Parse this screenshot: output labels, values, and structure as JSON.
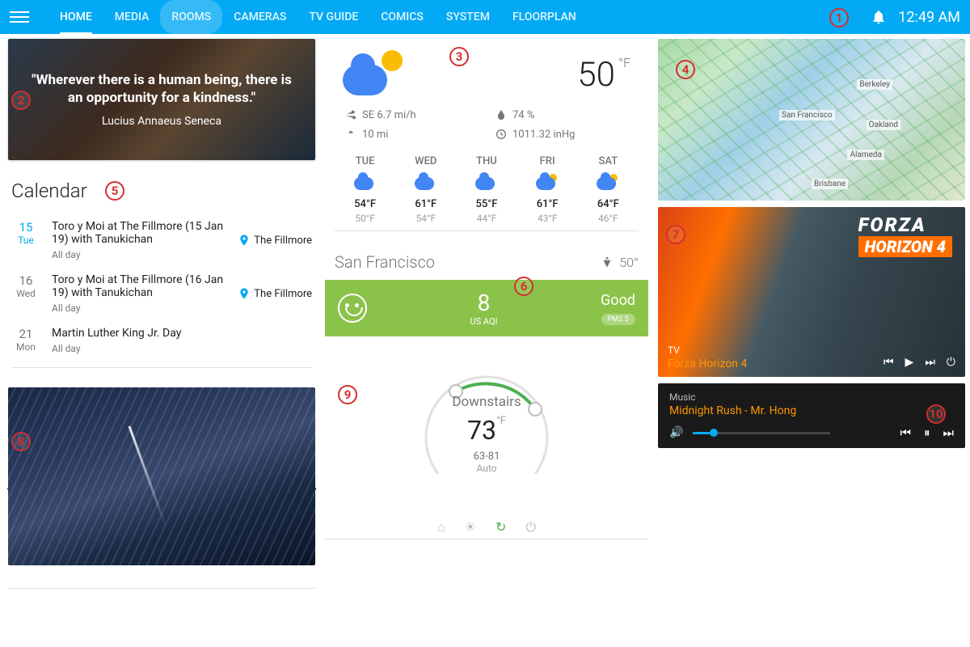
{
  "topbar": {
    "tabs": [
      "HOME",
      "MEDIA",
      "ROOMS",
      "CAMERAS",
      "TV GUIDE",
      "COMICS",
      "SYSTEM",
      "FLOORPLAN"
    ],
    "active_tab": "HOME",
    "highlight_tab": "ROOMS",
    "time": "12:49 AM"
  },
  "quote": {
    "text": "\"Wherever there is a human being, there is an opportunity for a kindness.\"",
    "author": "Lucius Annaeus Seneca"
  },
  "calendar": {
    "title": "Calendar",
    "events": [
      {
        "day": "15",
        "dow": "Tue",
        "highlight": true,
        "title": "Toro y Moi at The Fillmore (15 Jan 19) with Tanukichan",
        "time": "All day",
        "location": "The Fillmore"
      },
      {
        "day": "16",
        "dow": "Wed",
        "highlight": false,
        "title": "Toro y Moi at The Fillmore (16 Jan 19) with Tanukichan",
        "time": "All day",
        "location": "The Fillmore"
      },
      {
        "day": "21",
        "dow": "Mon",
        "highlight": false,
        "title": "Martin Luther King Jr. Day",
        "time": "All day",
        "location": ""
      }
    ]
  },
  "weather": {
    "temp": "50",
    "temp_unit": "°F",
    "wind": "SE 6.7 mi/h",
    "visibility": "10 mi",
    "humidity": "74 %",
    "pressure": "1011.32 inHg",
    "forecast": [
      {
        "day": "TUE",
        "hi": "54°F",
        "lo": "50°F",
        "sun": false
      },
      {
        "day": "WED",
        "hi": "61°F",
        "lo": "54°F",
        "sun": false
      },
      {
        "day": "THU",
        "hi": "55°F",
        "lo": "44°F",
        "sun": false
      },
      {
        "day": "FRI",
        "hi": "61°F",
        "lo": "43°F",
        "sun": true
      },
      {
        "day": "SAT",
        "hi": "64°F",
        "lo": "46°F",
        "sun": true
      }
    ]
  },
  "aqi": {
    "city": "San Francisco",
    "city_temp": "50°",
    "value": "8",
    "scale": "US AQI",
    "status": "Good",
    "pollutant": "PM2.5"
  },
  "thermostat": {
    "name": "Downstairs",
    "temp": "73",
    "unit": "°F",
    "range": "63-81",
    "mode": "Auto"
  },
  "map": {
    "labels": [
      "San Francisco",
      "Oakland",
      "Berkeley",
      "Alameda",
      "Brisbane"
    ]
  },
  "game": {
    "logo1": "FORZA",
    "logo2": "HORIZON 4",
    "source": "TV",
    "title": "Forza Horizon 4"
  },
  "music": {
    "source": "Music",
    "title": "Midnight Rush - Mr. Hong"
  },
  "annotations": [
    "1",
    "2",
    "3",
    "4",
    "5",
    "6",
    "7",
    "8",
    "9",
    "10"
  ]
}
